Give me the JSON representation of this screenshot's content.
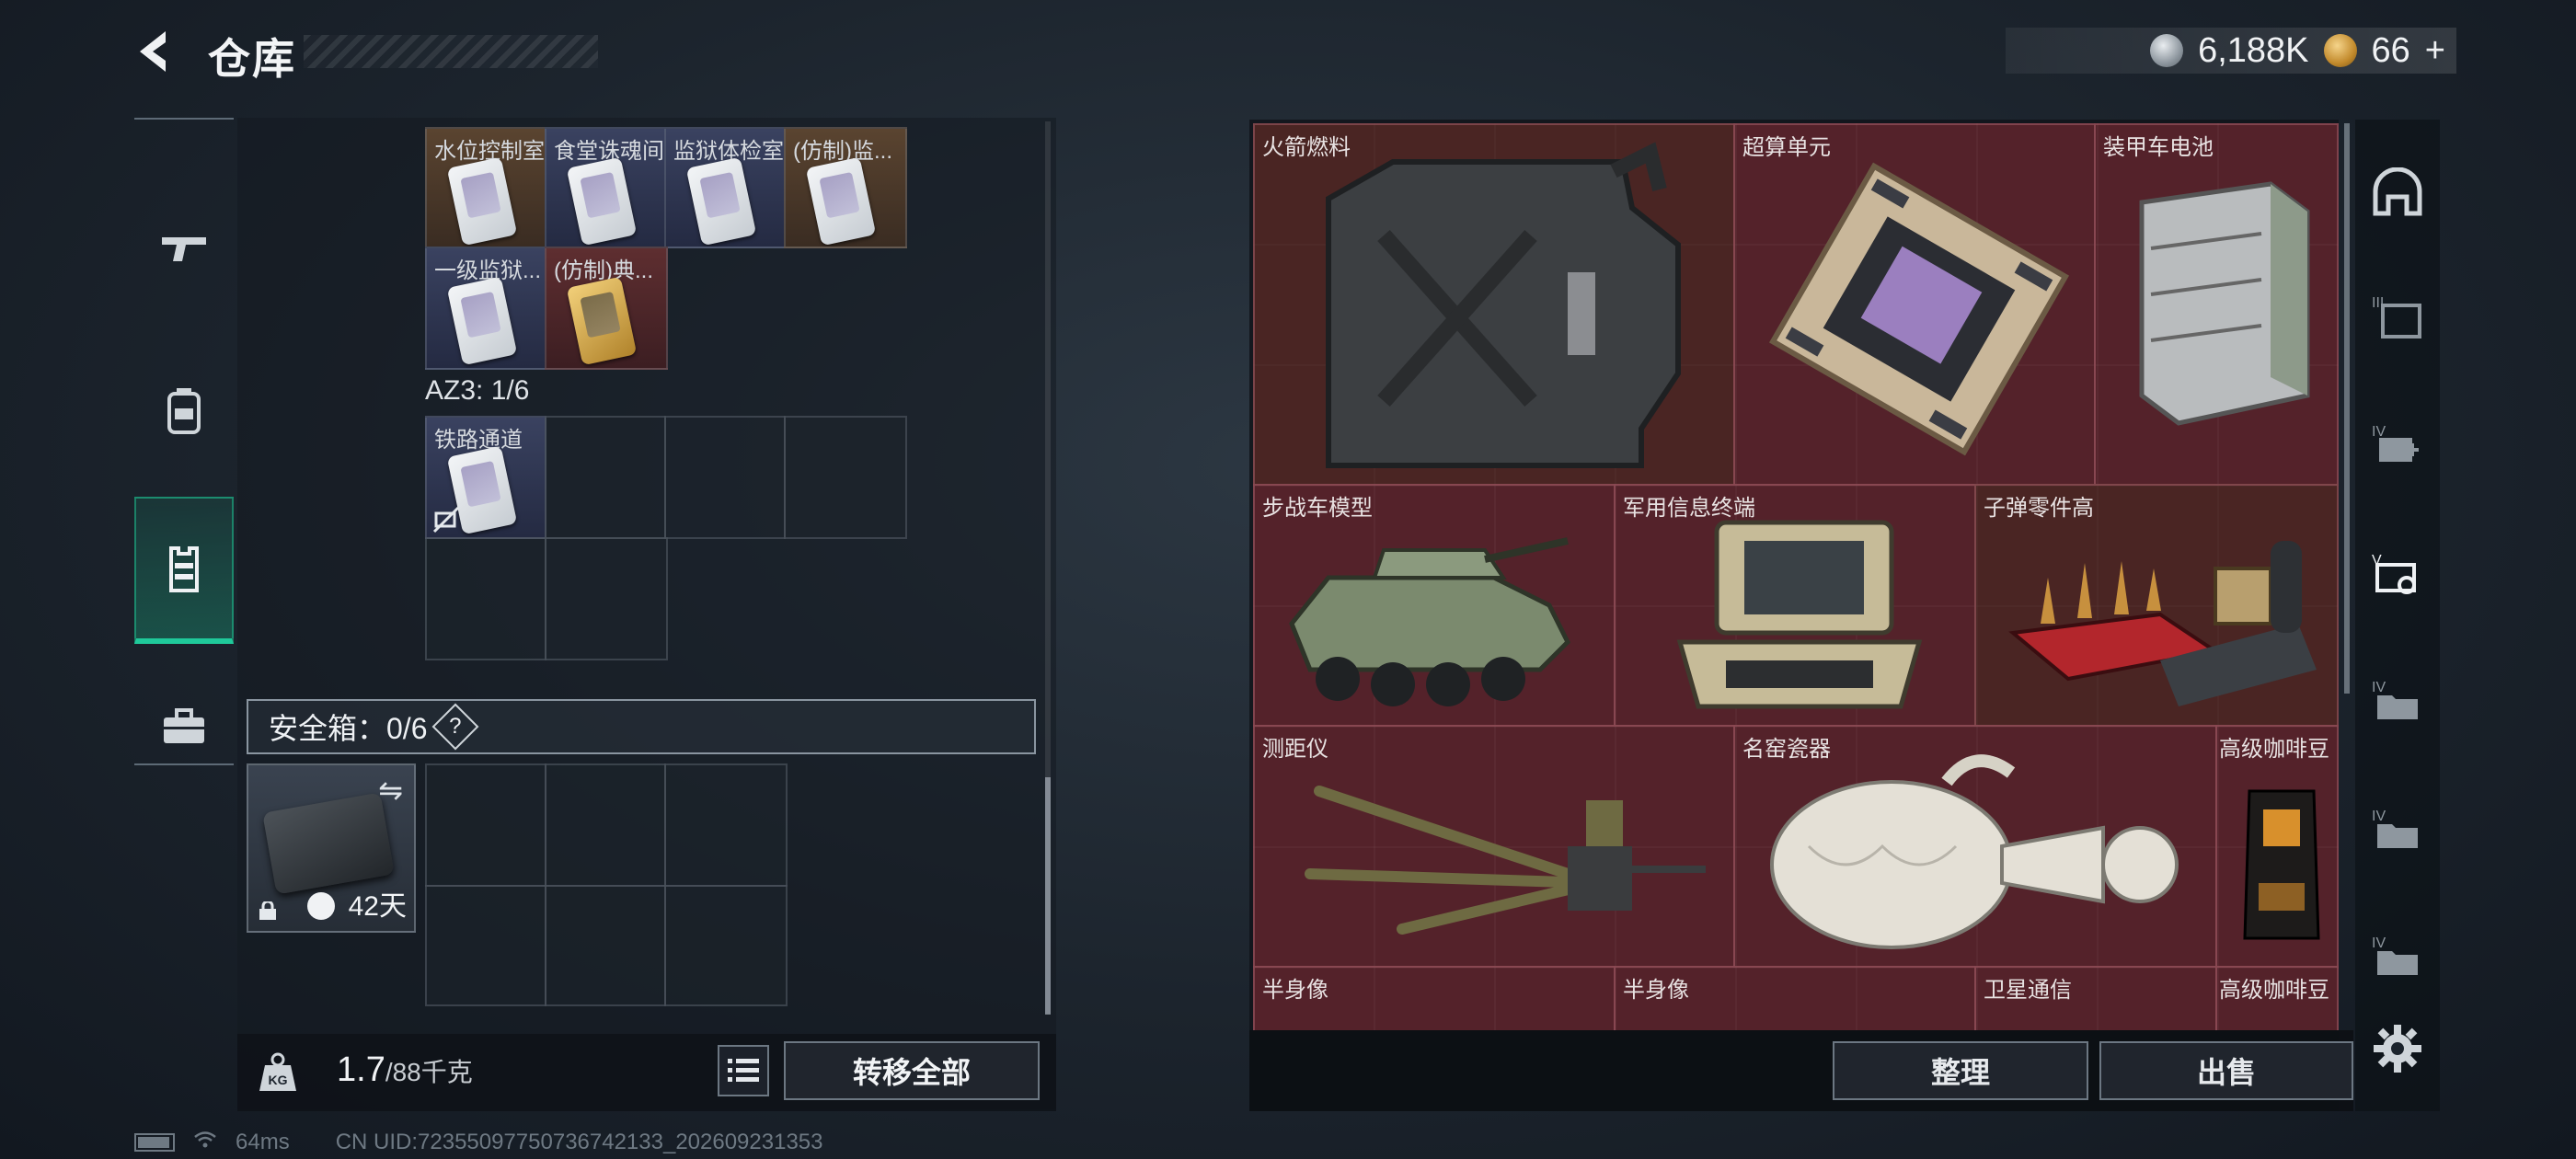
{
  "header": {
    "title": "仓库",
    "currency": [
      {
        "icon": "silver-coin-icon",
        "value": "6,188K"
      },
      {
        "icon": "gold-coin-icon",
        "value": "66"
      }
    ],
    "plus": "+"
  },
  "left_nav": [
    "gun-icon",
    "backpack-icon",
    "vest-icon",
    "briefcase-icon"
  ],
  "stash": {
    "row1": [
      {
        "label": "水位控制室",
        "color": "gold"
      },
      {
        "label": "食堂诛魂间",
        "color": "blue"
      },
      {
        "label": "监狱体检室",
        "color": "blue"
      },
      {
        "label": "(仿制)监...",
        "color": "gold"
      }
    ],
    "row2": [
      {
        "label": "一级监狱...",
        "color": "blue"
      },
      {
        "label": "(仿制)典...",
        "color": "red"
      }
    ],
    "az3_label": "AZ3: 1/6",
    "az3_item": {
      "label": "铁路通道"
    },
    "safebox_label": "安全箱：0/6",
    "help": "?",
    "safebox_case_days": "42天"
  },
  "left_footer": {
    "weight_current": "1.7",
    "weight_max": "/88千克",
    "transfer_all": "转移全部",
    "weight_icon_text": "KG"
  },
  "status": {
    "ping": "64ms",
    "uid": "CN UID:723550977507367421​33_202609231353"
  },
  "right_grid": {
    "items": [
      {
        "label": "火箭燃料"
      },
      {
        "label": "超算单元"
      },
      {
        "label": "装甲车电池"
      },
      {
        "label": "步战车模型"
      },
      {
        "label": "军用信息终端"
      },
      {
        "label": "子弹零件高"
      },
      {
        "label": "测距仪"
      },
      {
        "label": "名窑瓷器"
      },
      {
        "label": "高级咖啡豆"
      },
      {
        "label": "半身像"
      },
      {
        "label": "半身像"
      },
      {
        "label": "卫星通信"
      },
      {
        "label": "高级咖啡豆"
      }
    ]
  },
  "right_nav": [
    "helmet-icon",
    "armor-tier-3-icon",
    "medkit-tier-4-icon",
    "keycard-tier-5-icon",
    "folder-tier-4-icon",
    "folder-tier-4-icon",
    "folder-tier-4-icon"
  ],
  "right_footer": {
    "sort": "整理",
    "sell": "出售"
  }
}
